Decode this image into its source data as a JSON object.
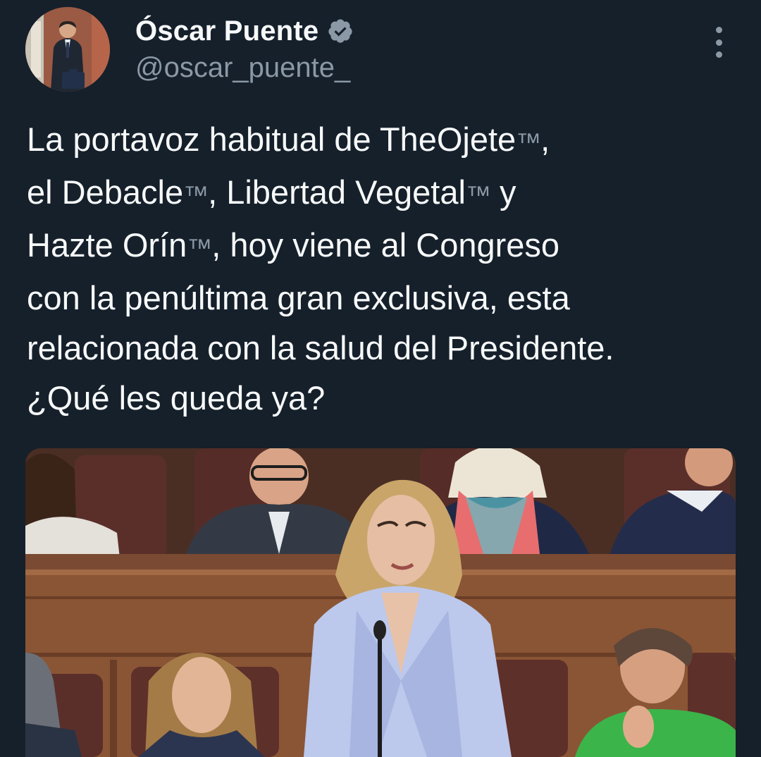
{
  "author": {
    "display_name": "Óscar Puente",
    "handle": "@oscar_puente_",
    "verified": true,
    "verified_icon": "verified-badge-icon"
  },
  "menu": {
    "icon": "more-vertical-icon"
  },
  "tweet": {
    "lines": [
      {
        "parts": [
          "La portavoz habitual de TheOjete",
          "™",
          ","
        ]
      },
      {
        "parts": [
          "el Debacle",
          "™",
          ", Libertad Vegetal",
          "™",
          " y"
        ]
      },
      {
        "parts": [
          "Hazte Orín",
          "™",
          ", hoy viene al Congreso"
        ]
      },
      {
        "parts": [
          "con la penúltima gran exclusiva, esta"
        ]
      },
      {
        "parts": [
          "relacionada con la salud del Presidente."
        ]
      },
      {
        "parts": [
          "¿Qué les queda ya?"
        ]
      }
    ]
  },
  "colors": {
    "background": "#15202b",
    "text": "#f7f9f9",
    "secondary": "#8b98a5"
  }
}
